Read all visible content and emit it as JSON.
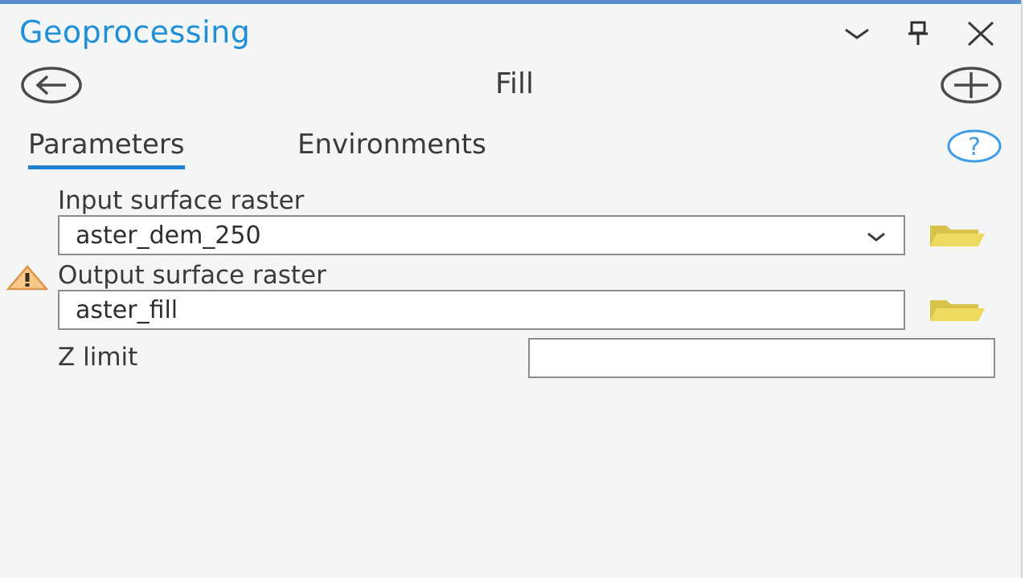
{
  "header": {
    "title": "Geoprocessing"
  },
  "tool": {
    "name": "Fill"
  },
  "tabs": [
    {
      "label": "Parameters"
    },
    {
      "label": "Environments"
    }
  ],
  "params": {
    "input_label": "Input surface raster",
    "input_value": "aster_dem_250",
    "output_label": "Output surface raster",
    "output_value": "aster_fill",
    "zlimit_label": "Z limit",
    "zlimit_value": ""
  }
}
